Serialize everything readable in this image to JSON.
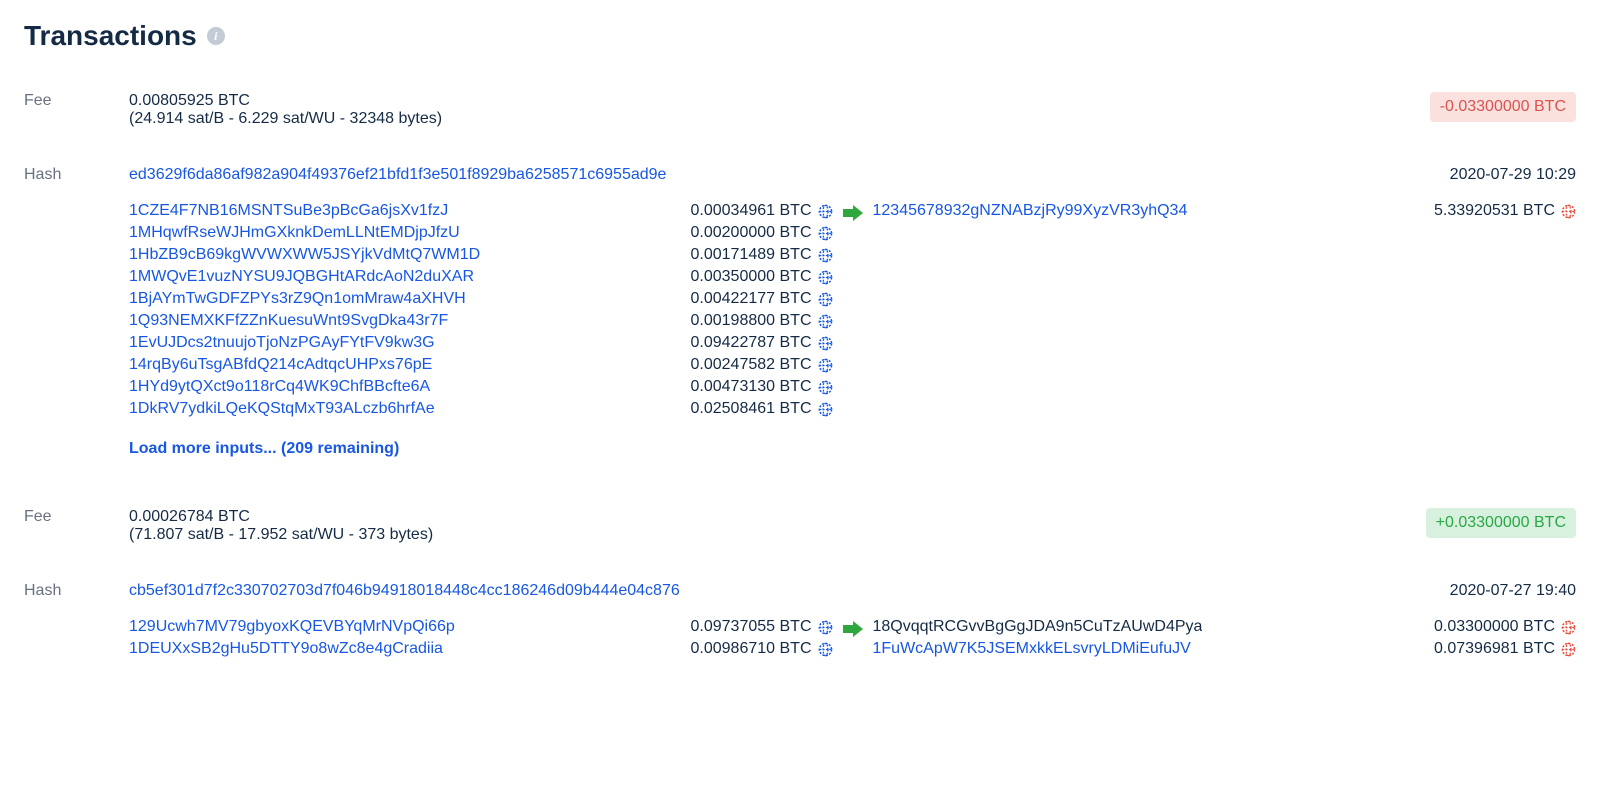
{
  "page_title": "Transactions",
  "labels": {
    "fee": "Fee",
    "hash": "Hash"
  },
  "transactions": [
    {
      "fee_amount": "0.00805925 BTC",
      "fee_detail": "(24.914 sat/B - 6.229 sat/WU - 32348 bytes)",
      "net_badge": {
        "text": "-0.03300000 BTC",
        "direction": "neg"
      },
      "hash": "ed3629f6da86af982a904f49376ef21bfd1f3e501f8929ba6258571c6955ad9e",
      "timestamp": "2020-07-29 10:29",
      "inputs": [
        {
          "address": "1CZE4F7NB16MSNTSuBe3pBcGa6jsXv1fzJ",
          "amount": "0.00034961 BTC",
          "globe": "blue"
        },
        {
          "address": "1MHqwfRseWJHmGXknkDemLLNtEMDjpJfzU",
          "amount": "0.00200000 BTC",
          "globe": "blue"
        },
        {
          "address": "1HbZB9cB69kgWVWXWW5JSYjkVdMtQ7WM1D",
          "amount": "0.00171489 BTC",
          "globe": "blue"
        },
        {
          "address": "1MWQvE1vuzNYSU9JQBGHtARdcAoN2duXAR",
          "amount": "0.00350000 BTC",
          "globe": "blue"
        },
        {
          "address": "1BjAYmTwGDFZPYs3rZ9Qn1omMraw4aXHVH",
          "amount": "0.00422177 BTC",
          "globe": "blue"
        },
        {
          "address": "1Q93NEMXKFfZZnKuesuWnt9SvgDka43r7F",
          "amount": "0.00198800 BTC",
          "globe": "blue"
        },
        {
          "address": "1EvUJDcs2tnuujoTjoNzPGAyFYtFV9kw3G",
          "amount": "0.09422787 BTC",
          "globe": "blue"
        },
        {
          "address": "14rqBy6uTsgABfdQ214cAdtqcUHPxs76pE",
          "amount": "0.00247582 BTC",
          "globe": "blue"
        },
        {
          "address": "1HYd9ytQXct9o118rCq4WK9ChfBBcfte6A",
          "amount": "0.00473130 BTC",
          "globe": "blue"
        },
        {
          "address": "1DkRV7ydkiLQeKQStqMxT93ALczb6hrfAe",
          "amount": "0.02508461 BTC",
          "globe": "blue"
        }
      ],
      "load_more": "Load more inputs... (209 remaining)",
      "outputs": [
        {
          "address": "12345678932gNZNABzjRy99XyzVR3yhQ34",
          "amount": "5.33920531 BTC",
          "globe": "red",
          "link": true
        }
      ]
    },
    {
      "fee_amount": "0.00026784 BTC",
      "fee_detail": "(71.807 sat/B - 17.952 sat/WU - 373 bytes)",
      "net_badge": {
        "text": "+0.03300000 BTC",
        "direction": "pos"
      },
      "hash": "cb5ef301d7f2c330702703d7f046b94918018448c4cc186246d09b444e04c876",
      "timestamp": "2020-07-27 19:40",
      "inputs": [
        {
          "address": "129Ucwh7MV79gbyoxKQEVBYqMrNVpQi66p",
          "amount": "0.09737055 BTC",
          "globe": "blue"
        },
        {
          "address": "1DEUXxSB2gHu5DTTY9o8wZc8e4gCradiia",
          "amount": "0.00986710 BTC",
          "globe": "blue"
        }
      ],
      "outputs": [
        {
          "address": "18QvqqtRCGvvBgGgJDA9n5CuTzAUwD4Pya",
          "amount": "0.03300000 BTC",
          "globe": "red",
          "link": false
        },
        {
          "address": "1FuWcApW7K5JSEMxkkELsvryLDMiEufuJV",
          "amount": "0.07396981 BTC",
          "globe": "red",
          "link": true
        }
      ]
    }
  ]
}
